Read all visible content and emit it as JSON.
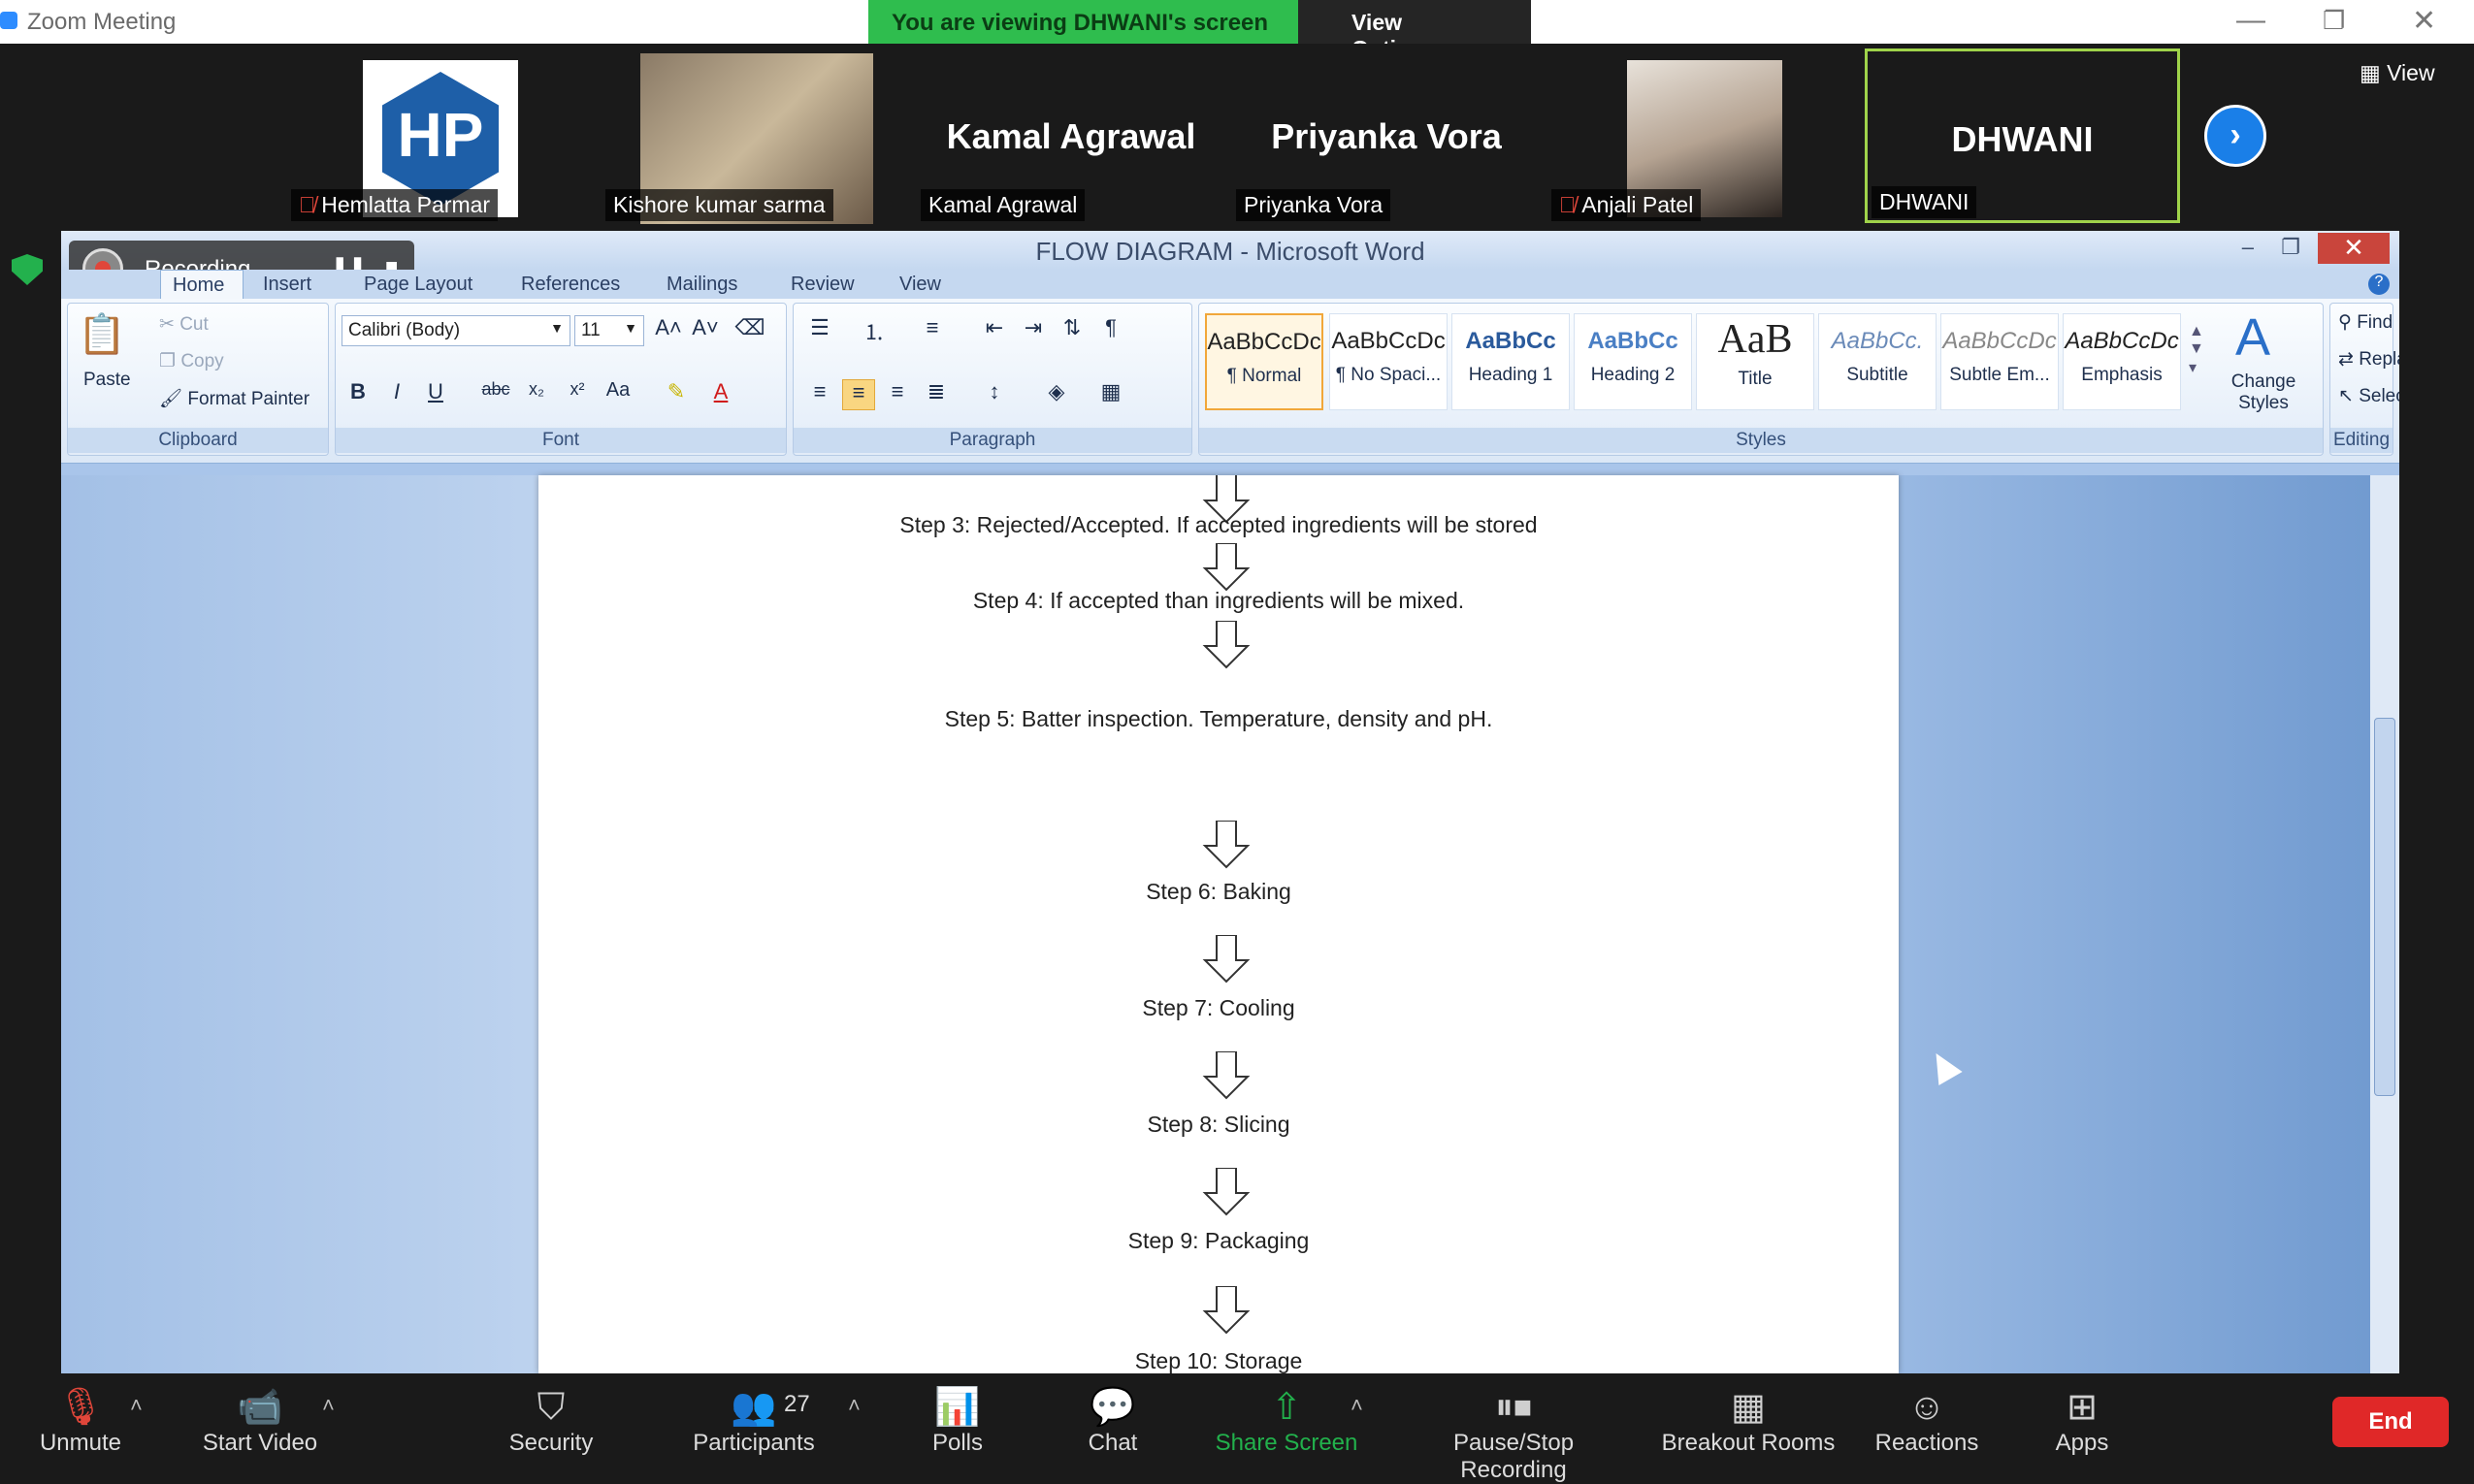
{
  "window": {
    "title": "Zoom Meeting"
  },
  "banner": {
    "viewing_text": "You are viewing DHWANI's screen",
    "view_options": "View Options"
  },
  "strip": {
    "view_label": "View",
    "tiles": [
      {
        "name_tag": "Hemlatta Parmar",
        "muted": true,
        "kind": "logo",
        "logo_text": "HP"
      },
      {
        "name_tag": "Kishore kumar sarma",
        "muted": false,
        "kind": "video"
      },
      {
        "name_tag": "Kamal Agrawal",
        "big_name": "Kamal Agrawal",
        "muted": false,
        "kind": "name"
      },
      {
        "name_tag": "Priyanka Vora",
        "big_name": "Priyanka Vora",
        "muted": false,
        "kind": "name"
      },
      {
        "name_tag": "Anjali Patel",
        "muted": true,
        "kind": "photo"
      },
      {
        "name_tag": "DHWANI",
        "big_name": "DHWANI",
        "muted": false,
        "kind": "name",
        "active": true
      }
    ]
  },
  "recording": {
    "label": "Recording..."
  },
  "word": {
    "title": "FLOW DIAGRAM - Microsoft Word",
    "tabs": [
      "Home",
      "Insert",
      "Page Layout",
      "References",
      "Mailings",
      "Review",
      "View"
    ],
    "clipboard": {
      "paste": "Paste",
      "cut": "Cut",
      "copy": "Copy",
      "format_painter": "Format Painter",
      "label": "Clipboard"
    },
    "font": {
      "name": "Calibri (Body)",
      "size": "11",
      "label": "Font"
    },
    "paragraph": {
      "label": "Paragraph"
    },
    "styles": {
      "label": "Styles",
      "change_styles": "Change Styles",
      "items": [
        {
          "sample": "AaBbCcDc",
          "name": "¶ Normal"
        },
        {
          "sample": "AaBbCcDc",
          "name": "¶ No Spaci..."
        },
        {
          "sample": "AaBbCc",
          "name": "Heading 1"
        },
        {
          "sample": "AaBbCc",
          "name": "Heading 2"
        },
        {
          "sample": "AaB",
          "name": "Title"
        },
        {
          "sample": "AaBbCc.",
          "name": "Subtitle"
        },
        {
          "sample": "AaBbCcDc",
          "name": "Subtle Em..."
        },
        {
          "sample": "AaBbCcDc",
          "name": "Emphasis"
        }
      ]
    },
    "editing": {
      "find": "Find",
      "replace": "Replace",
      "select": "Select",
      "label": "Editing"
    },
    "document": {
      "steps": [
        "Step 3: Rejected/Accepted. If accepted ingredients will be stored",
        "Step 4: If accepted than ingredients will be mixed.",
        "Step 5: Batter inspection. Temperature, density and pH.",
        "Step 6: Baking",
        "Step 7: Cooling",
        "Step 8: Slicing",
        "Step 9: Packaging",
        "Step 10: Storage"
      ]
    }
  },
  "toolbar": {
    "unmute": "Unmute",
    "start_video": "Start Video",
    "security": "Security",
    "participants": "Participants",
    "participant_count": "27",
    "polls": "Polls",
    "chat": "Chat",
    "share_screen": "Share Screen",
    "pause_stop_recording": "Pause/Stop Recording",
    "breakout_rooms": "Breakout Rooms",
    "reactions": "Reactions",
    "apps": "Apps",
    "end": "End"
  }
}
